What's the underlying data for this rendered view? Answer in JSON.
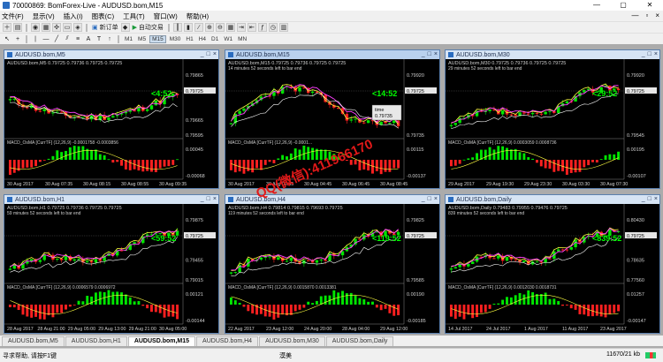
{
  "window": {
    "title": "70000869: BomForex-Live - AUDUSD.bom,M15",
    "min": "—",
    "max": "▢",
    "close": "✕"
  },
  "menu": {
    "items": [
      "文件(F)",
      "显示(V)",
      "插入(I)",
      "图表(C)",
      "工具(T)",
      "窗口(W)",
      "帮助(H)"
    ],
    "mdi": [
      "—",
      "▫",
      "×"
    ]
  },
  "toolbar": {
    "new_order": "新订单",
    "auto_trading": "自动交易",
    "timeframes": [
      "M1",
      "M5",
      "M15",
      "M30",
      "H1",
      "H4",
      "D1",
      "W1",
      "MN"
    ],
    "active_timeframe": "M15"
  },
  "colors": {
    "bull": "#00e600",
    "bear": "#ff2020",
    "chart_bg": "#000000",
    "price_tag": "#e6e6e6",
    "label": "#00ff00",
    "watermark": "#e21919"
  },
  "charts": [
    {
      "caption": "AUDUSD.bom,M5",
      "info": "AUDUSD.bom,M5  0.79725 0.79736 0.79725 0.79725",
      "timer": "<4:52",
      "macd": "MACD_OsMA [CurrTF] (12,26,9) -0.0001758 -0.0003856",
      "price_ticks": [
        "0.79865",
        "0.79755",
        "0.79725",
        "0.79665",
        "0.79595"
      ],
      "macd_ticks": [
        "0.00045",
        "-0.00068"
      ],
      "time_ticks": [
        "30 Aug 2017",
        "30 Aug 07:35",
        "30 Aug 08:15",
        "30 Aug 08:55",
        "30 Aug 09:35"
      ],
      "seed": 11,
      "trend": "updown"
    },
    {
      "caption": "AUDUSD.bom,M15",
      "info": "AUDUSD.bom,M15  0.79725 0.79736 0.79725 0.79725",
      "sub": "14 minutes 52 seconds left to bar end",
      "timer": "<14:52",
      "macd": "MACD_OsMA [CurrTF] (12,26,9) -0.0001...",
      "price_ticks": [
        "0.79920",
        "0.79725",
        "0.79735"
      ],
      "macd_ticks": [
        "0.00115",
        "-0.00137"
      ],
      "time_ticks": [
        "30 Aug 2017",
        "30 Aug 02:45",
        "30 Aug 04:45",
        "30 Aug 06:45",
        "30 Aug 08:45"
      ],
      "tooltip": [
        "time",
        "0.79735"
      ],
      "seed": 23,
      "trend": "hump"
    },
    {
      "caption": "AUDUSD.bom,M30",
      "info": "AUDUSD.bom,M30  0.79725 0.79736 0.79725 0.79725",
      "sub": "29 minutes 52 seconds left to bar end",
      "timer": "<29:52",
      "macd": "MACD_OsMA [CurrTF] (12,26,9) 0.0003059 0.0008736",
      "price_ticks": [
        "0.79920",
        "0.79725",
        "0.79545"
      ],
      "macd_ticks": [
        "0.00195",
        "-0.00107"
      ],
      "time_ticks": [
        "29 Aug 2017",
        "29 Aug 19:30",
        "29 Aug 23:30",
        "30 Aug 03:30",
        "30 Aug 07:30"
      ],
      "seed": 37,
      "trend": "rise"
    },
    {
      "caption": "AUDUSD.bom,H1",
      "info": "AUDUSD.bom,H1  0.79725 0.79736 0.79725 0.79725",
      "sub": "59 minutes 52 seconds left to bar end",
      "timer": "<59:52",
      "macd": "MACD_OsMA [CurrTF] (12,26,9) 0.0006579 0.0006972",
      "price_ticks": [
        "0.79875",
        "0.79725",
        "0.79455",
        "0.79015"
      ],
      "macd_ticks": [
        "0.00121",
        "-0.00144"
      ],
      "time_ticks": [
        "28 Aug 2017",
        "28 Aug 21:00",
        "29 Aug 05:00",
        "29 Aug 13:00",
        "29 Aug 21:00",
        "30 Aug 05:00"
      ],
      "seed": 41,
      "trend": "rise"
    },
    {
      "caption": "AUDUSD.bom,H4",
      "info": "AUDUSD.bom,H4  0.79814 0.79815 0.79693 0.79725",
      "sub": "119 minutes 52 seconds left to bar end",
      "timer": "<119:52",
      "macd": "MACD_OsMA [CurrTF] (12,26,9) 0.0015870 0.0013381",
      "price_ticks": [
        "0.79825",
        "0.79725",
        "0.79585"
      ],
      "macd_ticks": [
        "0.00190",
        "-0.00185"
      ],
      "time_ticks": [
        "22 Aug 2017",
        "23 Aug 12:00",
        "24 Aug 20:00",
        "28 Aug 04:00",
        "29 Aug 12:00"
      ],
      "seed": 53,
      "trend": "rise"
    },
    {
      "caption": "AUDUSD.bom,Daily",
      "info": "AUDUSD.bom,Daily  0.79483 0.79955 0.79476 0.79725",
      "sub": "839 minutes 52 seconds left to bar end",
      "timer": "<839:52",
      "macd": "MACD_OsMA [CurrTF] (12,26,9) 0.0012030 0.0018731",
      "price_ticks": [
        "0.80430",
        "0.79725",
        "0.78635",
        "0.77560"
      ],
      "macd_ticks": [
        "0.01257",
        "-0.00147"
      ],
      "time_ticks": [
        "14 Jul 2017",
        "24 Jul 2017",
        "1 Aug 2017",
        "11 Aug 2017",
        "23 Aug 2017"
      ],
      "seed": 67,
      "trend": "rise"
    }
  ],
  "watermark": "QQ(微信):411966170",
  "tabs": [
    "AUDUSD.bom,M5",
    "AUDUSD.bom,H1",
    "AUDUSD.bom,M15",
    "AUDUSD.bom,H4",
    "AUDUSD.bom,M30",
    "AUDUSD.bom,Daily"
  ],
  "active_tab": 2,
  "status": {
    "help": "寻求帮助, 请按F1键",
    "middle": "漠美",
    "traffic": "11670/21 kb"
  }
}
